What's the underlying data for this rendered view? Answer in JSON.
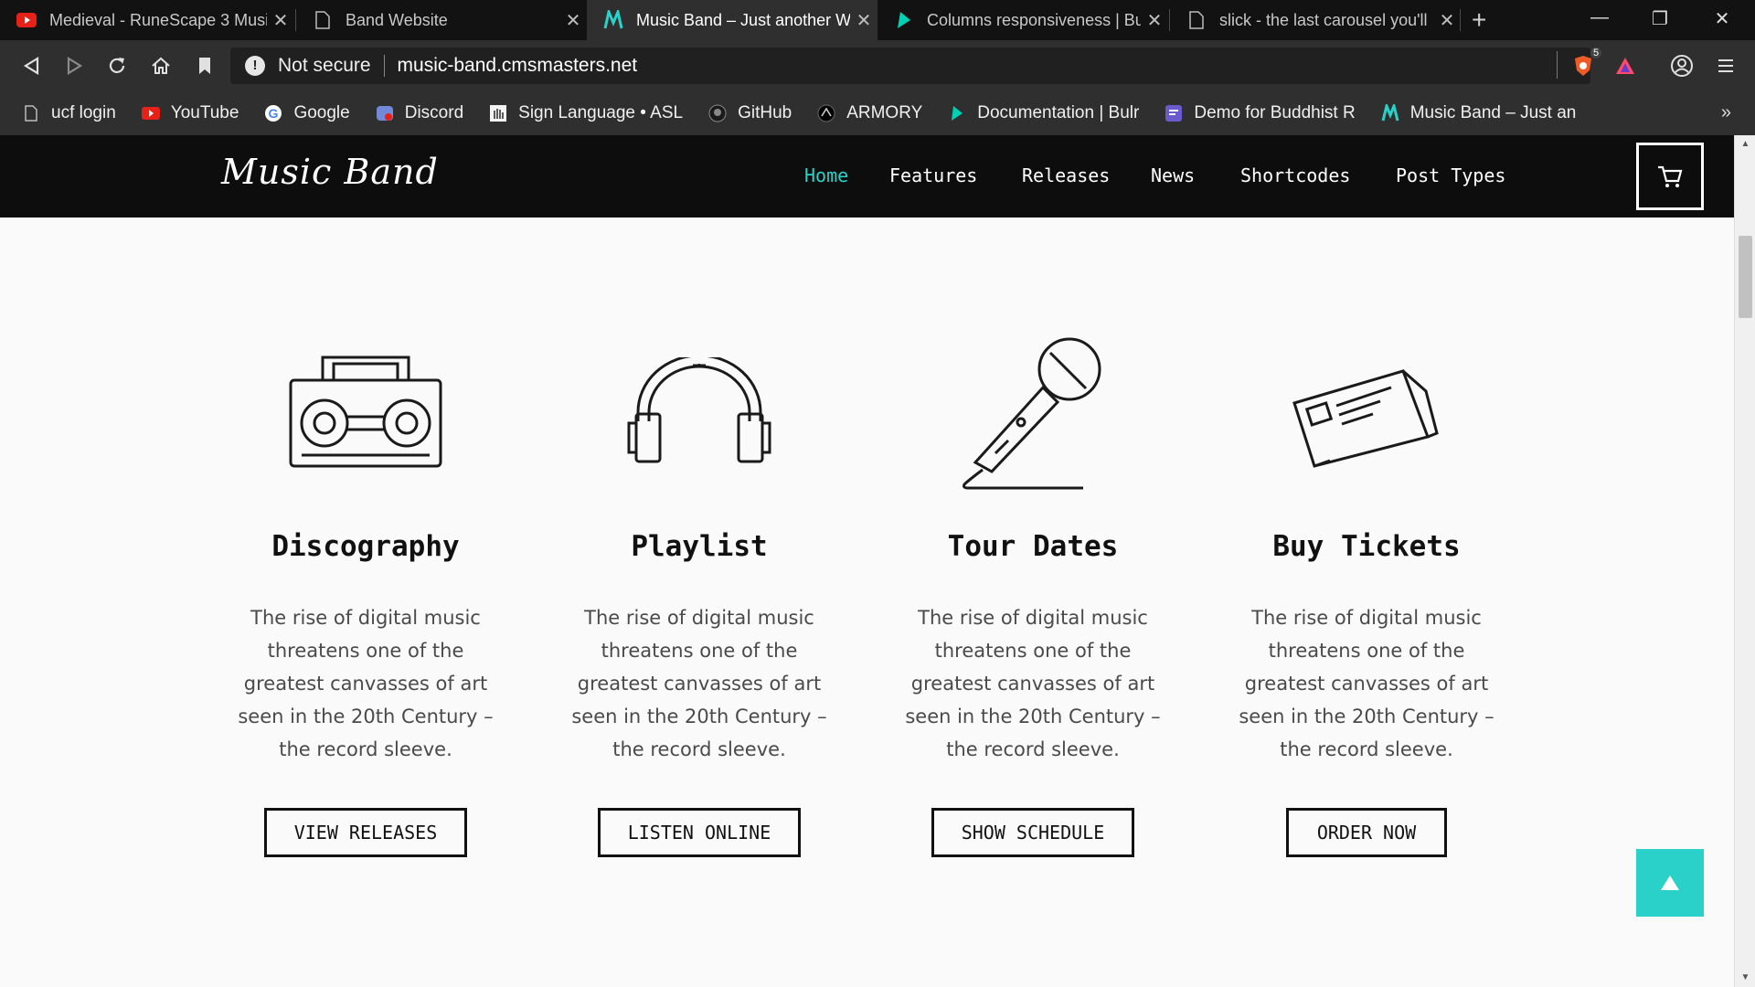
{
  "browser": {
    "tabs": [
      {
        "title": "Medieval - RuneScape 3 Musi",
        "icon": "youtube-icon"
      },
      {
        "title": "Band Website",
        "icon": "page-icon"
      },
      {
        "title": "Music Band – Just another W",
        "icon": "music-band-icon"
      },
      {
        "title": "Columns responsiveness | Bul",
        "icon": "bulma-icon"
      },
      {
        "title": "slick - the last carousel you'll",
        "icon": "page-icon"
      }
    ],
    "address": {
      "security_label": "Not secure",
      "url": "music-band.cmsmasters.net"
    },
    "bookmarks": [
      {
        "label": "ucf login",
        "icon": "page-icon"
      },
      {
        "label": "YouTube",
        "icon": "youtube-icon"
      },
      {
        "label": "Google",
        "icon": "google-icon"
      },
      {
        "label": "Discord",
        "icon": "discord-icon"
      },
      {
        "label": "Sign Language • ASL",
        "icon": "asl-icon"
      },
      {
        "label": "GitHub",
        "icon": "github-icon"
      },
      {
        "label": "ARMORY",
        "icon": "armory-icon"
      },
      {
        "label": "Documentation | Bulr",
        "icon": "bulma-icon"
      },
      {
        "label": "Demo for Buddhist R",
        "icon": "demo-icon"
      },
      {
        "label": "Music Band – Just an",
        "icon": "music-band-icon"
      }
    ],
    "brave_badge": "5"
  },
  "site": {
    "logo": "Music Band",
    "nav": [
      "Home",
      "Features",
      "Releases",
      "News",
      "Shortcodes",
      "Post Types"
    ],
    "active_nav": "Home",
    "accent_color": "#2ad1c9"
  },
  "features": [
    {
      "icon": "boombox-icon",
      "title": "Discography",
      "text": "The rise of digital music threatens one of the greatest canvasses of art seen in the 20th Century – the record sleeve.",
      "button": "VIEW RELEASES"
    },
    {
      "icon": "headphones-icon",
      "title": "Playlist",
      "text": "The rise of digital music threatens one of the greatest canvasses of art seen in the 20th Century – the record sleeve.",
      "button": "LISTEN ONLINE"
    },
    {
      "icon": "microphone-icon",
      "title": "Tour Dates",
      "text": "The rise of digital music threatens one of the greatest canvasses of art seen in the 20th Century – the record sleeve.",
      "button": "SHOW SCHEDULE"
    },
    {
      "icon": "tickets-icon",
      "title": "Buy Tickets",
      "text": "The rise of digital music threatens one of the greatest canvasses of art seen in the 20th Century – the record sleeve.",
      "button": "ORDER NOW"
    }
  ]
}
